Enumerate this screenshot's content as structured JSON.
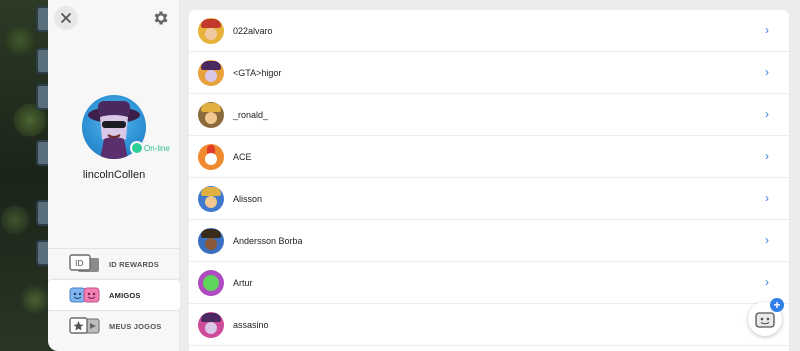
{
  "profile": {
    "username": "lincolnCollen",
    "status": "On-line",
    "avatar_icon": "mortis-avatar-icon"
  },
  "menu": [
    {
      "label": "ID REWARDS",
      "icon": "id-rewards-icon",
      "active": false
    },
    {
      "label": "AMIGOS",
      "icon": "friends-icon",
      "active": true
    },
    {
      "label": "MEUS JOGOS",
      "icon": "my-games-icon",
      "active": false
    }
  ],
  "friends": [
    {
      "name": "022alvaro",
      "avatar": "red-helmet-avatar"
    },
    {
      "name": "<GTA>higor",
      "avatar": "mortis-avatar"
    },
    {
      "name": "_ronald_",
      "avatar": "barbarian-avatar"
    },
    {
      "name": "ACE",
      "avatar": "chicken-avatar"
    },
    {
      "name": "Alisson",
      "avatar": "barbarian-avatar"
    },
    {
      "name": "Andersson Borba",
      "avatar": "hog-rider-avatar"
    },
    {
      "name": "Artur",
      "avatar": "spike-avatar"
    },
    {
      "name": "assasino",
      "avatar": "mortis-avatar"
    }
  ],
  "colors": {
    "accent": "#3b7de0",
    "online": "#2fcf9a"
  }
}
